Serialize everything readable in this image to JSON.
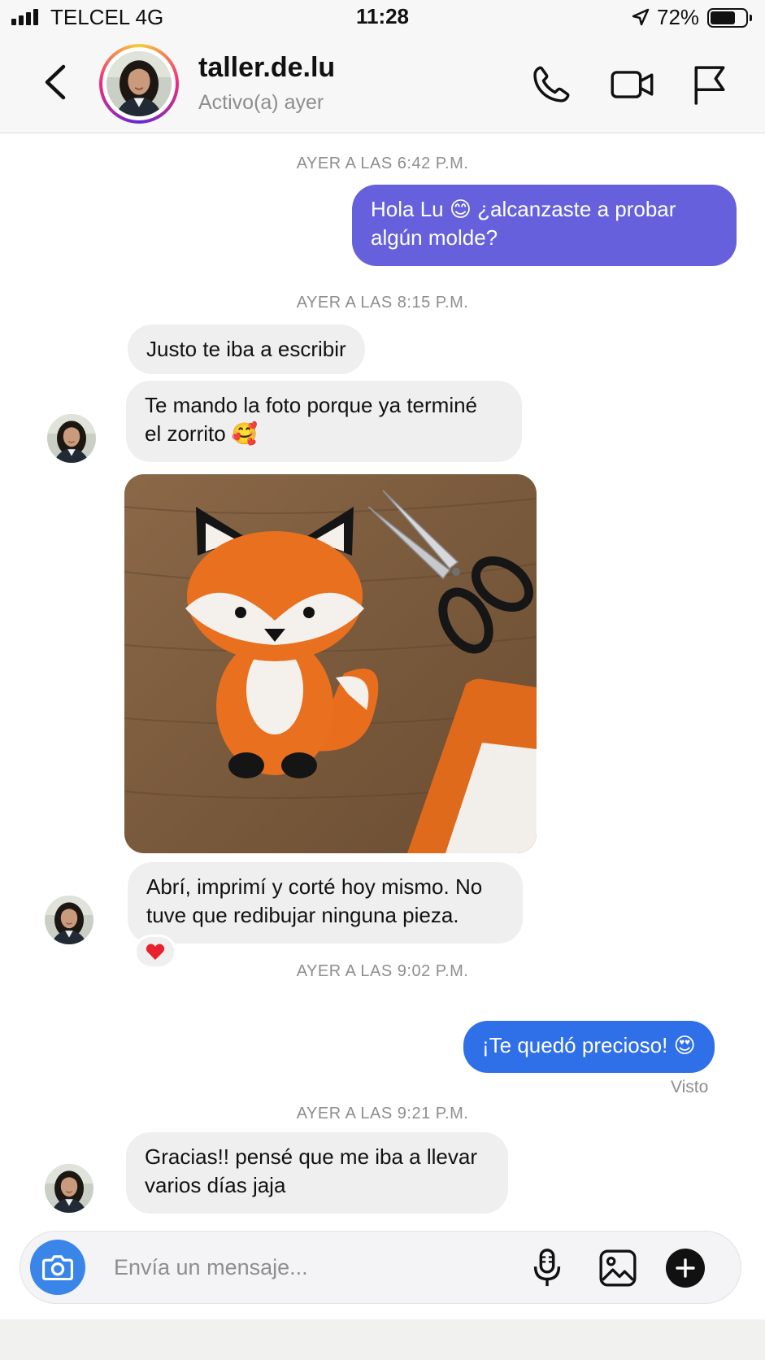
{
  "status_bar": {
    "carrier": "TELCEL 4G",
    "time": "11:28",
    "battery_percent": "72%",
    "battery_level": 0.72,
    "signal_bars": 4
  },
  "header": {
    "contact_name": "taller.de.lu",
    "contact_status": "Activo(a) ayer",
    "icons": [
      "back-chevron-icon",
      "phone-icon",
      "video-camera-icon",
      "flag-icon"
    ]
  },
  "colors": {
    "outgoing_purple": "#6660dd",
    "outgoing_blue": "#2f6fe8",
    "incoming_bubble": "#efefef",
    "camera_button": "#3a86e8"
  },
  "conversation": {
    "timestamps": [
      "AYER A LAS 6:42 P.M.",
      "AYER A LAS 8:15 P.M.",
      "AYER A LAS 9:02 P.M.",
      "AYER A LAS 9:21 P.M."
    ],
    "messages": [
      {
        "direction": "outgoing",
        "lines": [
          "Hola Lu 😊 ¿alcanzaste a probar",
          "algún molde?"
        ]
      },
      {
        "direction": "incoming",
        "lines": [
          "Justo te iba a escribir"
        ]
      },
      {
        "direction": "incoming",
        "lines": [
          "Te mando la foto porque ya terminé",
          "el zorrito 🥰"
        ]
      },
      {
        "direction": "incoming",
        "type": "photo",
        "subject": "felt fox"
      },
      {
        "direction": "incoming",
        "lines": [
          "Abrí, imprimí y corté hoy mismo. No",
          "tuve que redibujar ninguna pieza."
        ],
        "reaction": "❤️"
      },
      {
        "direction": "outgoing",
        "lines": [
          "¡Te quedó precioso! 😍"
        ]
      },
      {
        "direction": "incoming",
        "lines": [
          "Gracias!! pensé que me iba a llevar",
          "varios días jaja"
        ]
      }
    ],
    "seen_label": "Visto"
  },
  "composer": {
    "placeholder": "Envía un mensaje...",
    "value": "",
    "icons": [
      "camera-icon",
      "microphone-icon",
      "gallery-icon",
      "plus-icon"
    ]
  }
}
